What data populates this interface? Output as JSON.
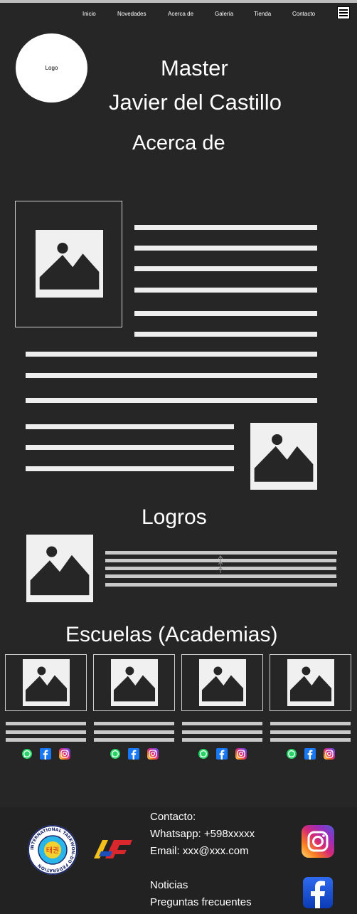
{
  "nav": {
    "items": [
      "Inicio",
      "Novedades",
      "Acerca de",
      "Galería",
      "Tienda",
      "Contacto"
    ]
  },
  "header": {
    "logo_label": "Logo",
    "title_line1": "Master",
    "title_line2": "Javier del Castillo"
  },
  "about": {
    "heading": "Acerca de"
  },
  "achievements": {
    "heading": "Logros"
  },
  "schools": {
    "heading": "Escuelas (Academias)",
    "count": 4
  },
  "footer": {
    "contact_heading": "Contacto:",
    "whatsapp": "Whatsapp: +598xxxxx",
    "email": "Email: xxx@xxx.com",
    "news_link": "Noticias",
    "faq_link": "Preguntas frecuentes",
    "itf_emblem_ring_text": "INTERNATIONAL TAEKWON-DO FEDERATION",
    "itf_emblem_center_text": "태권",
    "itf_mark": "ITF"
  },
  "colors": {
    "background": "#262626",
    "footer_background": "#222222",
    "placeholder_fill": "#f0f0f0",
    "placeholder_icon": "#262626",
    "whatsapp": "#25D366",
    "facebook": "#1877F2",
    "instagram_gradient": [
      "#feda75",
      "#fa7e1e",
      "#d62976",
      "#962fbf",
      "#4f5bd5"
    ]
  },
  "icons": {
    "menu": "hamburger-icon",
    "placeholder": "image-placeholder-icon",
    "whatsapp": "whatsapp-icon",
    "facebook": "facebook-icon",
    "instagram": "instagram-icon"
  }
}
